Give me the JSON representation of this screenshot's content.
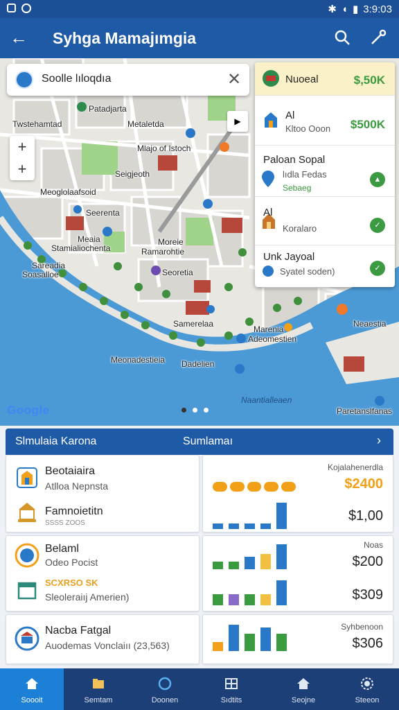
{
  "status": {
    "time": "3:9:03"
  },
  "appbar": {
    "title": "Syhga Mamajımgia"
  },
  "search": {
    "value": "Soolle lıloqdıa"
  },
  "map": {
    "labels": [
      "Patadjarta",
      "Twstehamtad",
      "Metaletda",
      "Mlajo of Istoch",
      "Seigjeoth",
      "Meoglolaafsoid",
      "Seerenta",
      "Meaia",
      "Stamialiochenta",
      "Moreie",
      "Ramarohtie",
      "Sareadia",
      "Soasalloe",
      "Seoretia",
      "Samerelaa",
      "Marenia",
      "Adeomestien",
      "Neaestia",
      "Meonadestieia",
      "Dadelien",
      "Naantialleaen",
      "Paretanslfanas"
    ],
    "attribution": "Google"
  },
  "places": [
    {
      "title": "Nuoeal",
      "price": "$,50K"
    },
    {
      "title": "Al",
      "subtitle": "Kltoo Ooon",
      "price": "$500K"
    },
    {
      "title": "Paloan Sopal",
      "subtitle": "lıdla Fedas",
      "tag": "Sebaeg"
    },
    {
      "title": "Al",
      "subtitle": "Koralaro"
    },
    {
      "title": "Unk Jayoal",
      "subtitle": "Syatel soden)"
    }
  ],
  "summary": {
    "left": "Slmulaia Karona",
    "right": "Sumlamaı"
  },
  "cards": [
    {
      "name": "Beotaiaira",
      "sub": "Atlloa Nepnsta"
    },
    {
      "name": "Famnoietitn",
      "sub": "SSSS ZOOS"
    },
    {
      "name": "Belaml",
      "sub": "Odeo Pocist"
    },
    {
      "name": "SCXRSO SK",
      "sub": "Sleoleraiıj Amerien)"
    },
    {
      "name": "Nacba Fatgal",
      "sub": "Auodemas  Vonclaiıı (23,563)"
    }
  ],
  "stats": [
    {
      "header": "Kojalahenerdla",
      "value": "$2400"
    },
    {
      "value": "$1,00"
    },
    {
      "header": "Noas",
      "value": "$200"
    },
    {
      "value": "$309"
    },
    {
      "header": "Syhbenoon",
      "value": "$306"
    }
  ],
  "chart_data": [
    {
      "type": "bar",
      "series": [
        {
          "values": [
            1,
            1,
            1,
            1,
            1
          ]
        }
      ]
    },
    {
      "type": "bar",
      "series": [
        {
          "values": [
            0.2,
            0.2,
            0.2,
            0.2,
            1.0
          ]
        }
      ]
    },
    {
      "type": "bar",
      "series": [
        {
          "values": [
            0.3,
            0.3,
            0.5,
            0.6,
            1.0
          ]
        }
      ]
    },
    {
      "type": "bar",
      "series": [
        {
          "values": [
            0.4,
            0.4,
            0.4,
            0.4,
            0.9
          ]
        }
      ]
    },
    {
      "type": "bar",
      "series": [
        {
          "values": [
            0.3,
            0.9,
            0.6,
            0.8,
            0.6
          ]
        }
      ]
    }
  ],
  "nav": [
    "Soooit",
    "Semtam",
    "Doonen",
    "Sıdtits",
    "Seojne",
    "Steeon"
  ],
  "colors": {
    "primary": "#1f5aa6",
    "accent": "#f2a018",
    "green": "#3a9a3e",
    "water": "#4b9ad6"
  }
}
